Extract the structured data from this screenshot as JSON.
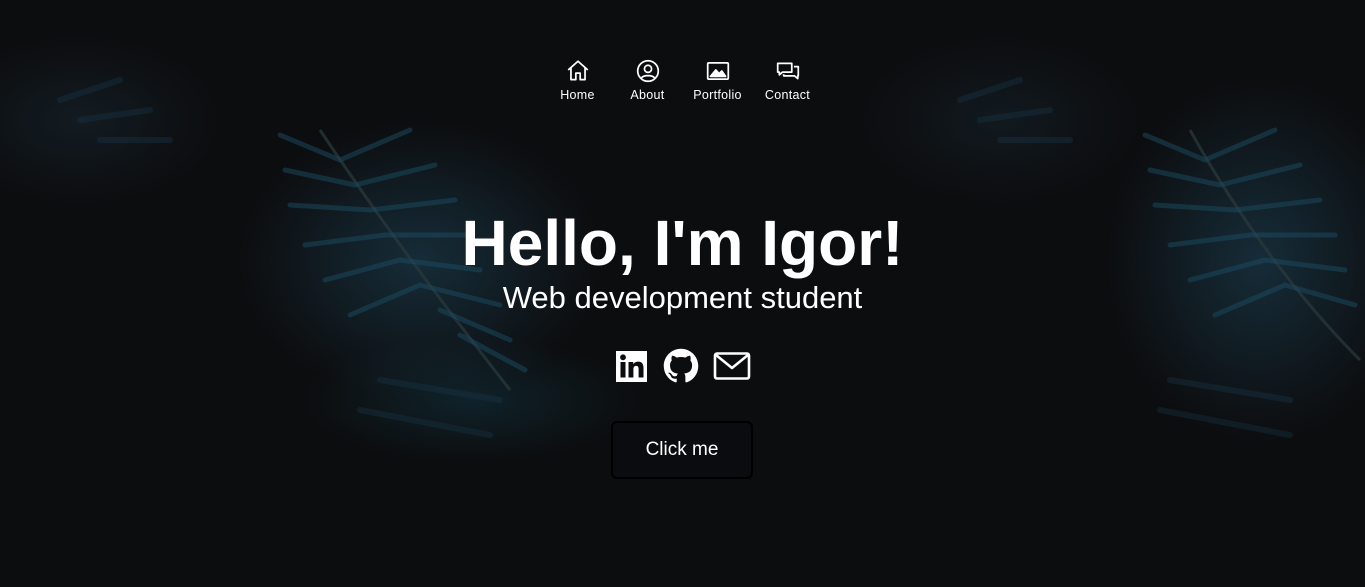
{
  "nav": {
    "items": [
      {
        "label": "Home",
        "icon": "home-icon"
      },
      {
        "label": "About",
        "icon": "user-circle-icon"
      },
      {
        "label": "Portfolio",
        "icon": "image-icon"
      },
      {
        "label": "Contact",
        "icon": "chat-icon"
      }
    ]
  },
  "hero": {
    "title": "Hello, I'm Igor!",
    "subtitle": "Web development student",
    "button_label": "Click me"
  },
  "socials": [
    {
      "name": "linkedin-icon"
    },
    {
      "name": "github-icon"
    },
    {
      "name": "mail-icon"
    }
  ],
  "colors": {
    "background": "#0c0d0f",
    "text": "#ffffff",
    "accent_foliage": "#1e4a5c",
    "button_border": "#000000"
  }
}
